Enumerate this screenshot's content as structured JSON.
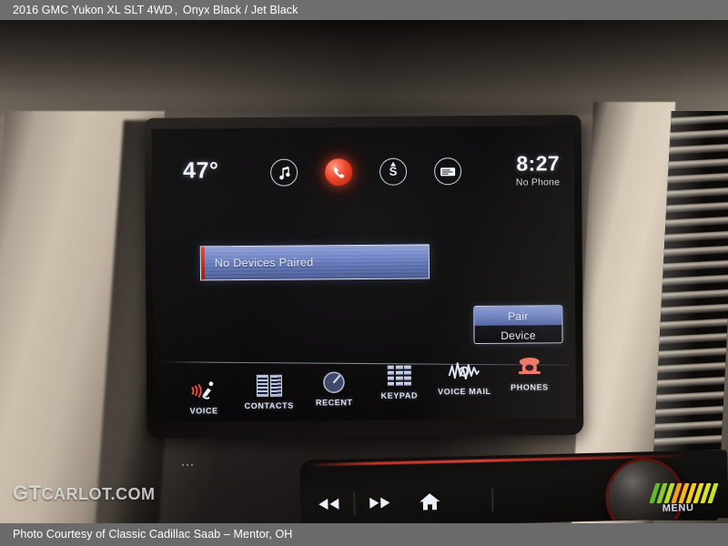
{
  "caption": {
    "top_vehicle": "2016 GMC Yukon XL SLT 4WD",
    "top_separator": ",",
    "top_colors": "Onyx Black / Jet Black",
    "bottom": "Photo Courtesy of Classic Cadillac Saab – Mentor, OH"
  },
  "infotainment": {
    "status": {
      "temperature": "47°",
      "clock": "8:27",
      "phone_status": "No Phone",
      "icons": [
        {
          "name": "music-note-icon",
          "label": "Audio"
        },
        {
          "name": "phone-handset-icon",
          "label": "Phone",
          "active": true,
          "color": "#ef4b30"
        },
        {
          "name": "compass-navigation-icon",
          "label": "Navigation",
          "heading": "S"
        },
        {
          "name": "message-card-icon",
          "label": "Messages"
        }
      ]
    },
    "device_list": {
      "rows": [
        {
          "label": "No Devices Paired"
        }
      ],
      "accent_color": "#d94a3a",
      "row_gradient_top": "#8e9fd6",
      "row_gradient_bottom": "#47588f"
    },
    "pair_button": {
      "line1": "Pair",
      "line2": "Device"
    },
    "toolbar": [
      {
        "label": "VOICE",
        "icon": "voice-recognition-icon"
      },
      {
        "label": "CONTACTS",
        "icon": "contacts-book-icon"
      },
      {
        "label": "RECENT",
        "icon": "recent-clock-icon"
      },
      {
        "label": "KEYPAD",
        "icon": "keypad-grid-icon"
      },
      {
        "label": "VOICE MAIL",
        "icon": "voice-mail-waveform-icon"
      },
      {
        "label": "PHONES",
        "icon": "telephone-icon"
      }
    ]
  },
  "console": {
    "buttons": [
      {
        "name": "rewind-button",
        "glyph": "◀◀"
      },
      {
        "name": "fast-forward-button",
        "glyph": "▶▶"
      },
      {
        "name": "home-button",
        "glyph": "home-icon"
      }
    ],
    "knob_label": "MENU"
  },
  "watermark": {
    "text_bold": "GT",
    "text_rest": "CARLOT.COM"
  }
}
